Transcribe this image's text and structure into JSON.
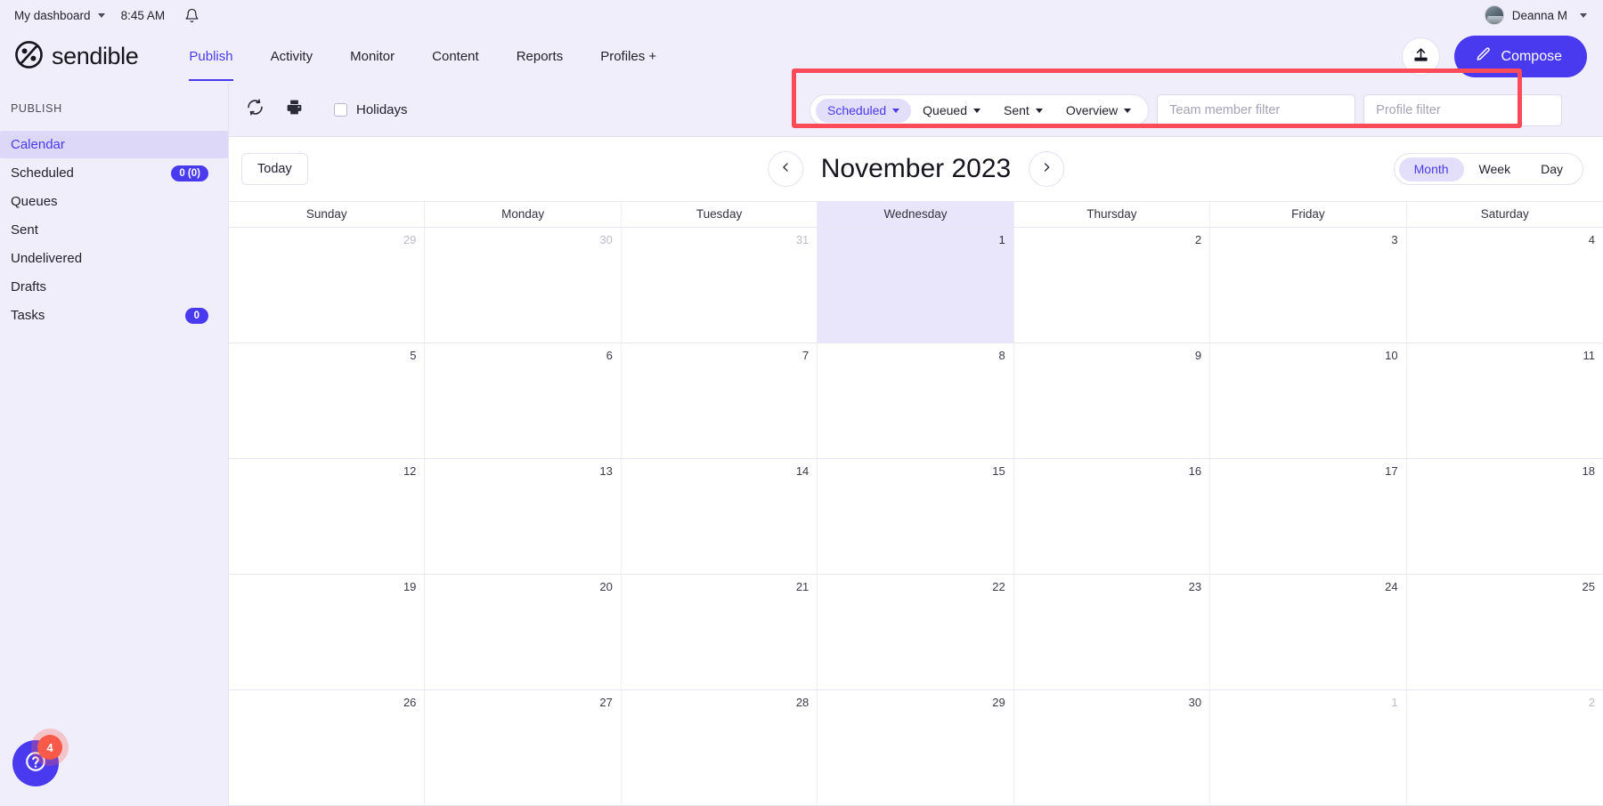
{
  "utility_bar": {
    "dashboard_label": "My dashboard",
    "time": "8:45 AM",
    "bell_icon": "bell-icon",
    "user_name": "Deanna M"
  },
  "nav": {
    "brand": "sendible",
    "links": [
      {
        "label": "Publish",
        "active": true
      },
      {
        "label": "Activity",
        "active": false
      },
      {
        "label": "Monitor",
        "active": false
      },
      {
        "label": "Content",
        "active": false
      },
      {
        "label": "Reports",
        "active": false
      },
      {
        "label": "Profiles +",
        "active": false
      }
    ],
    "upload_icon": "upload-icon",
    "compose_label": "Compose",
    "compose_icon": "pencil-icon",
    "accent_color": "#4a3aef"
  },
  "sidebar": {
    "heading": "PUBLISH",
    "items": [
      {
        "label": "Calendar",
        "badge": "",
        "active": true
      },
      {
        "label": "Scheduled",
        "badge": "0 (0)",
        "active": false
      },
      {
        "label": "Queues",
        "badge": "",
        "active": false
      },
      {
        "label": "Sent",
        "badge": "",
        "active": false
      },
      {
        "label": "Undelivered",
        "badge": "",
        "active": false
      },
      {
        "label": "Drafts",
        "badge": "",
        "active": false
      },
      {
        "label": "Tasks",
        "badge": "0",
        "active": false
      }
    ],
    "help": {
      "icon": "question-mark-icon",
      "notification_count": "4"
    }
  },
  "filter_bar": {
    "refresh_icon": "refresh-icon",
    "print_icon": "print-icon",
    "holidays_label": "Holidays",
    "holidays_checked": false,
    "highlight_color": "#fb4b58",
    "pills": [
      {
        "label": "Scheduled",
        "active": true
      },
      {
        "label": "Queued",
        "active": false
      },
      {
        "label": "Sent",
        "active": false
      },
      {
        "label": "Overview",
        "active": false
      }
    ],
    "team_member_filter": {
      "value": "",
      "placeholder": "Team member filter"
    },
    "profile_filter": {
      "value": "",
      "placeholder": "Profile filter"
    }
  },
  "calendar_toolbar": {
    "today_label": "Today",
    "prev_icon": "chevron-left-icon",
    "next_icon": "chevron-right-icon",
    "month_title": "November 2023",
    "views": [
      {
        "label": "Month",
        "active": true
      },
      {
        "label": "Week",
        "active": false
      },
      {
        "label": "Day",
        "active": false
      }
    ]
  },
  "calendar": {
    "day_names": [
      "Sunday",
      "Monday",
      "Tuesday",
      "Wednesday",
      "Thursday",
      "Friday",
      "Saturday"
    ],
    "today_column_index": 3,
    "weeks": [
      [
        {
          "day": "29",
          "other_month": true,
          "today": false
        },
        {
          "day": "30",
          "other_month": true,
          "today": false
        },
        {
          "day": "31",
          "other_month": true,
          "today": false
        },
        {
          "day": "1",
          "other_month": false,
          "today": true
        },
        {
          "day": "2",
          "other_month": false,
          "today": false
        },
        {
          "day": "3",
          "other_month": false,
          "today": false
        },
        {
          "day": "4",
          "other_month": false,
          "today": false
        }
      ],
      [
        {
          "day": "5",
          "other_month": false,
          "today": false
        },
        {
          "day": "6",
          "other_month": false,
          "today": false
        },
        {
          "day": "7",
          "other_month": false,
          "today": false
        },
        {
          "day": "8",
          "other_month": false,
          "today": false
        },
        {
          "day": "9",
          "other_month": false,
          "today": false
        },
        {
          "day": "10",
          "other_month": false,
          "today": false
        },
        {
          "day": "11",
          "other_month": false,
          "today": false
        }
      ],
      [
        {
          "day": "12",
          "other_month": false,
          "today": false
        },
        {
          "day": "13",
          "other_month": false,
          "today": false
        },
        {
          "day": "14",
          "other_month": false,
          "today": false
        },
        {
          "day": "15",
          "other_month": false,
          "today": false
        },
        {
          "day": "16",
          "other_month": false,
          "today": false
        },
        {
          "day": "17",
          "other_month": false,
          "today": false
        },
        {
          "day": "18",
          "other_month": false,
          "today": false
        }
      ],
      [
        {
          "day": "19",
          "other_month": false,
          "today": false
        },
        {
          "day": "20",
          "other_month": false,
          "today": false
        },
        {
          "day": "21",
          "other_month": false,
          "today": false
        },
        {
          "day": "22",
          "other_month": false,
          "today": false
        },
        {
          "day": "23",
          "other_month": false,
          "today": false
        },
        {
          "day": "24",
          "other_month": false,
          "today": false
        },
        {
          "day": "25",
          "other_month": false,
          "today": false
        }
      ],
      [
        {
          "day": "26",
          "other_month": false,
          "today": false
        },
        {
          "day": "27",
          "other_month": false,
          "today": false
        },
        {
          "day": "28",
          "other_month": false,
          "today": false
        },
        {
          "day": "29",
          "other_month": false,
          "today": false
        },
        {
          "day": "30",
          "other_month": false,
          "today": false
        },
        {
          "day": "1",
          "other_month": true,
          "today": false
        },
        {
          "day": "2",
          "other_month": true,
          "today": false
        }
      ]
    ]
  }
}
